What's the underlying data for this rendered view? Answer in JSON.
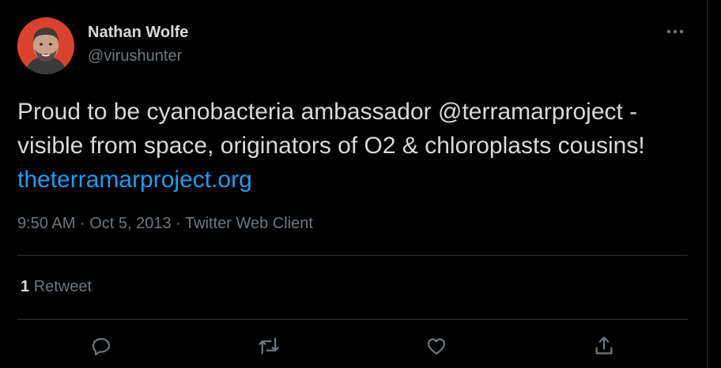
{
  "author": {
    "name": "Nathan Wolfe",
    "handle": "@virushunter",
    "avatar_bg": "#d9422f"
  },
  "tweet": {
    "text": "Proud to be cyanobacteria ambassador @terramarproject - visible from space, originators of O2 & chloroplasts cousins!",
    "link_text": "theterramarproject.org"
  },
  "meta": {
    "time": "9:50 AM",
    "separator": "·",
    "date": "Oct 5, 2013",
    "client": "Twitter Web Client"
  },
  "stats": {
    "retweet_count": "1",
    "retweet_label": "Retweet"
  },
  "icons": {
    "more": "more-horizontal-icon",
    "reply": "reply-icon",
    "retweet": "retweet-icon",
    "like": "like-icon",
    "share": "share-icon"
  },
  "colors": {
    "background": "#000000",
    "text": "#d9d9d9",
    "secondary": "#6e767d",
    "link": "#1d9bf0",
    "divider": "#2f3336"
  }
}
